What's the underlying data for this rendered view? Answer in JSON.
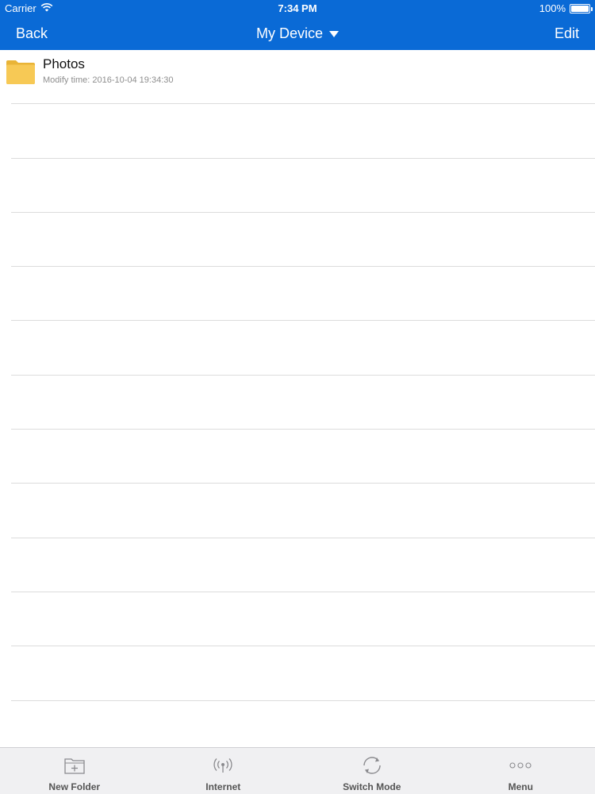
{
  "status_bar": {
    "carrier": "Carrier",
    "time": "7:34 PM",
    "battery": "100%",
    "battery_level": 1.0
  },
  "nav": {
    "back_label": "Back",
    "title": "My Device",
    "edit_label": "Edit"
  },
  "files": [
    {
      "name": "Photos",
      "meta": "Modify time: 2016-10-04 19:34:30",
      "icon": "folder-icon"
    }
  ],
  "tabs": [
    {
      "label": "New Folder",
      "icon": "new-folder-icon"
    },
    {
      "label": "Internet",
      "icon": "wifi-broadcast-icon"
    },
    {
      "label": "Switch Mode",
      "icon": "switch-mode-icon"
    },
    {
      "label": "Menu",
      "icon": "more-icon"
    }
  ],
  "colors": {
    "header": "#0a6ad6",
    "folder": "#f5c54a",
    "tab_bar": "#f0f0f2"
  }
}
